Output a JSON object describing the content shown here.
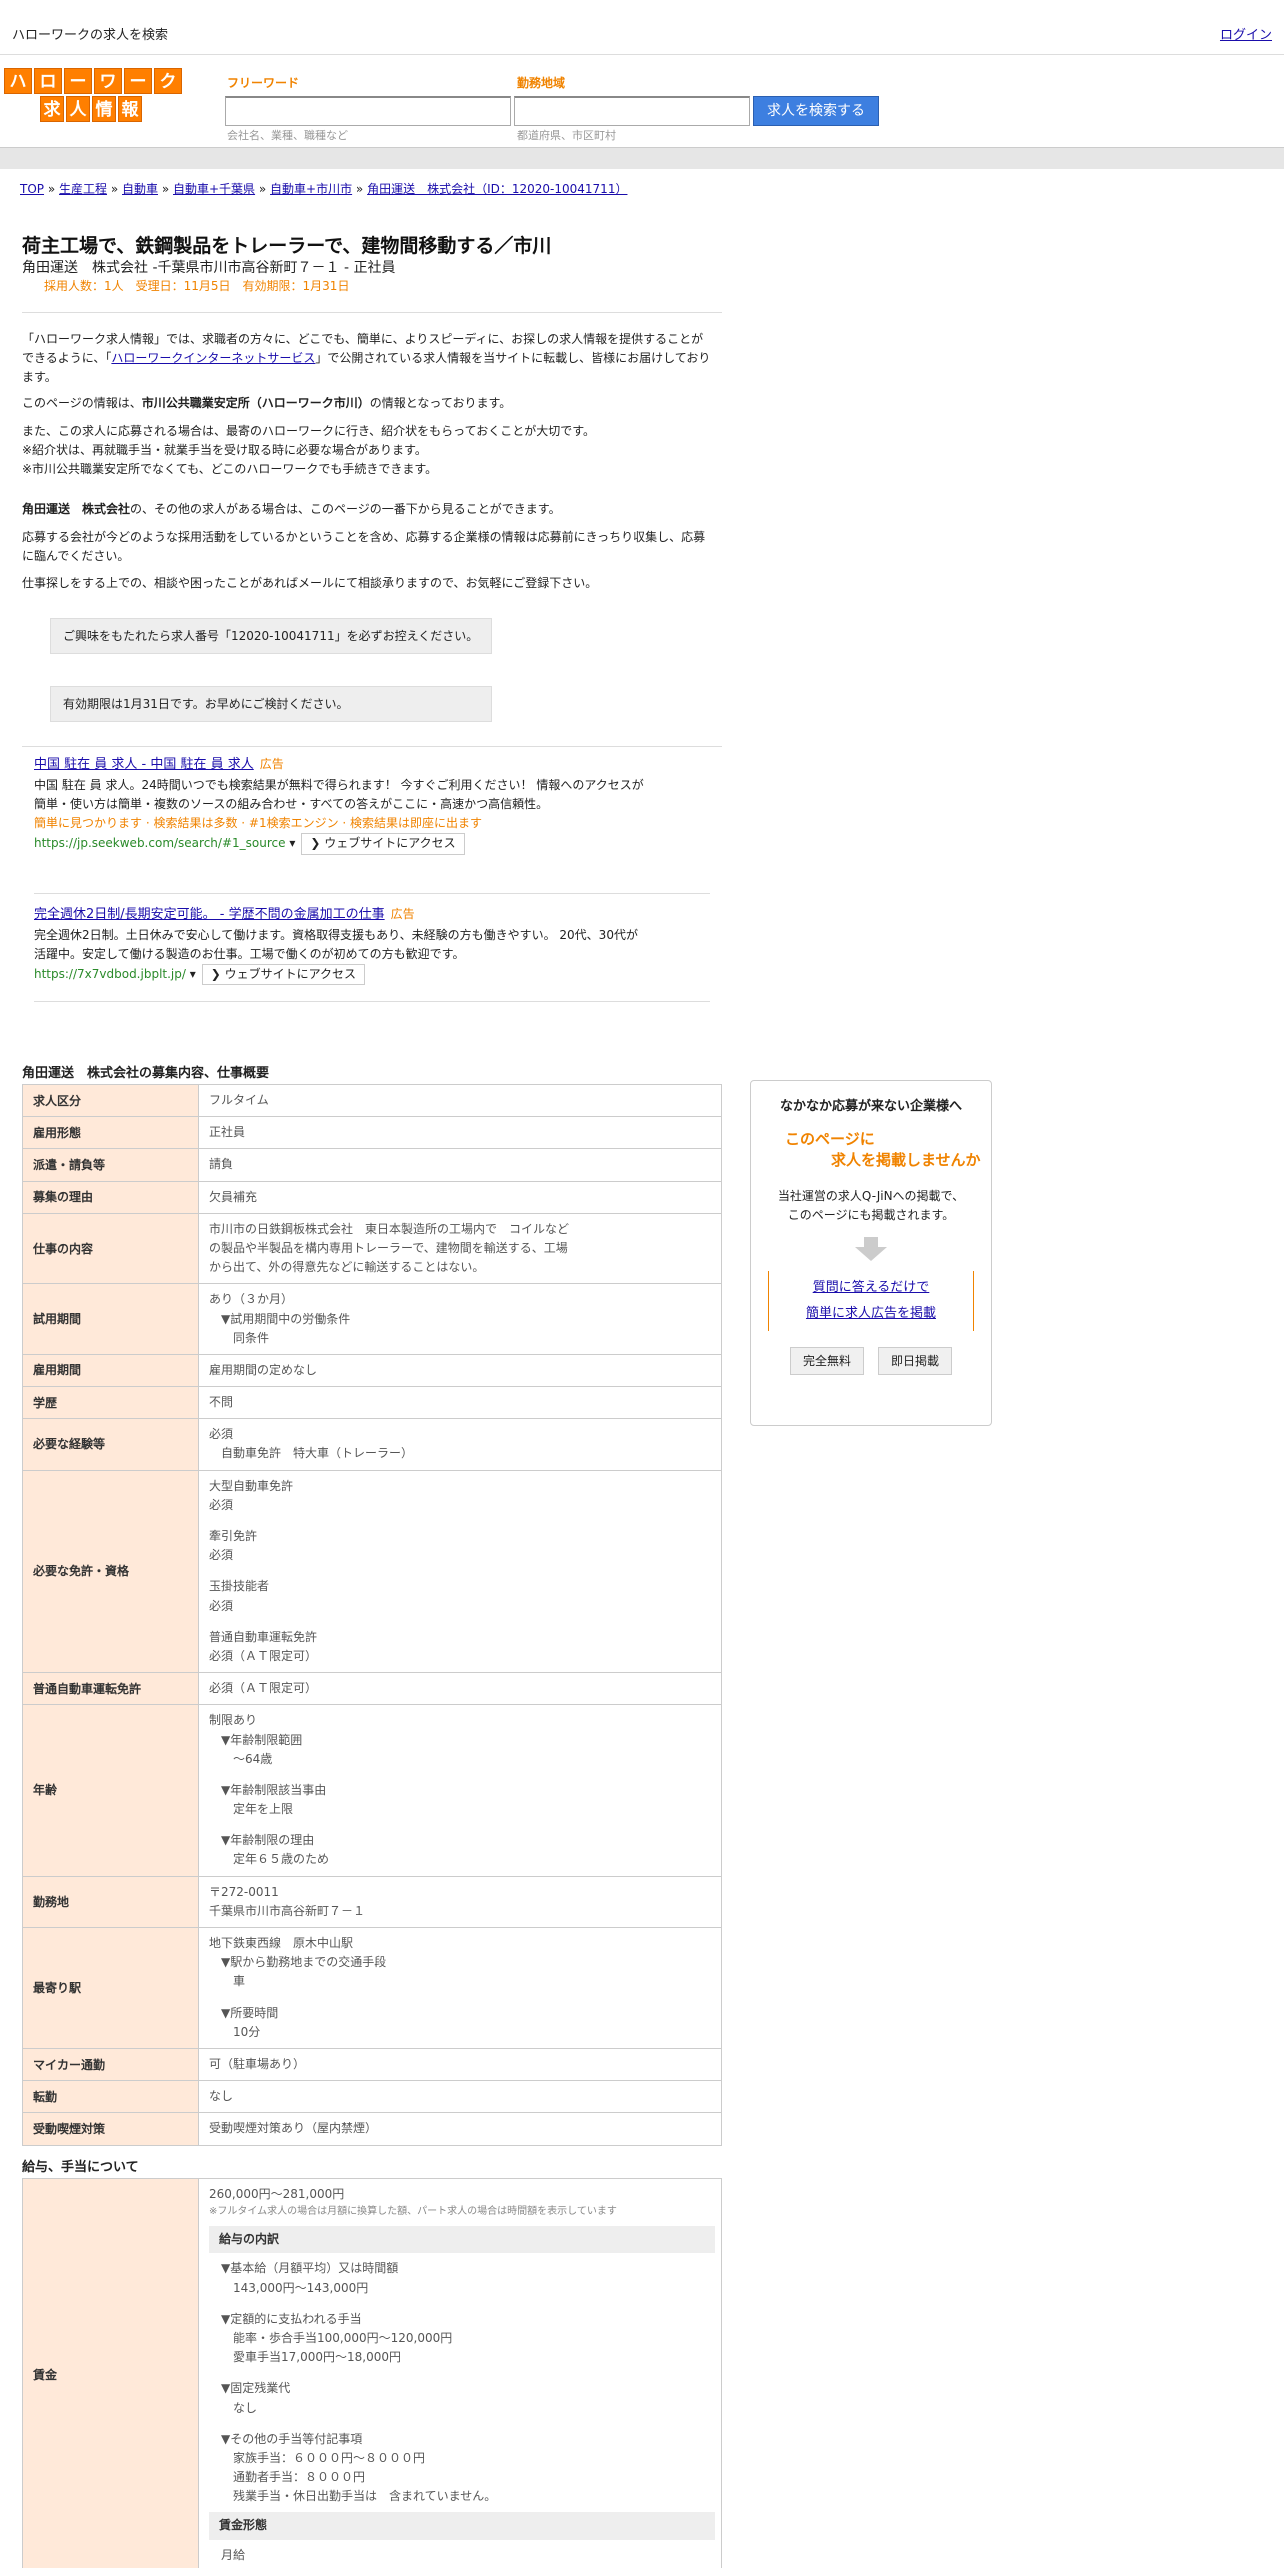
{
  "header": {
    "title": "ハローワークの求人を検索",
    "login": "ログイン"
  },
  "logo": {
    "row1": [
      "ハ",
      "ロ",
      "ー",
      "ワ",
      "ー",
      "ク"
    ],
    "row2": [
      "求",
      "人",
      "情",
      "報"
    ]
  },
  "search": {
    "freeword_label": "フリーワード",
    "freeword_placeholder": "会社名、業種、職種など",
    "area_label": "勤務地域",
    "area_placeholder": "都道府県、市区町村",
    "button": "求人を検索する"
  },
  "breadcrumb": [
    "TOP",
    "生産工程",
    "自動車",
    "自動車+千葉県",
    "自動車+市川市",
    "角田運送　株式会社（ID：12020-10041711）"
  ],
  "job": {
    "title": "荷主工場で、鉄鋼製品をトレーラーで、建物間移動する／市川",
    "subtitle": "角田運送　株式会社 -千葉県市川市高谷新町７－１ - 正社員",
    "meta": "採用人数：1人　受理日：11月5日　有効期限：1月31日"
  },
  "intro": {
    "p1a": "「ハローワーク求人情報」では、求職者の方々に、どこでも、簡単に、よりスピーディに、お探しの求人情報を提供することができるように、「",
    "p1link": "ハローワークインターネットサービス",
    "p1b": "」で公開されている求人情報を当サイトに転載し、皆様にお届けしております。",
    "p2a": "このページの情報は、",
    "p2b": "市川公共職業安定所（ハローワーク市川）",
    "p2c": "の情報となっております。",
    "p3": "また、この求人に応募される場合は、最寄のハローワークに行き、紹介状をもらっておくことが大切です。",
    "p4": "※紹介状は、再就職手当・就業手当を受け取る時に必要な場合があります。",
    "p5": "※市川公共職業安定所でなくても、どこのハローワークでも手続きできます。",
    "p6a": "角田運送　株式会社",
    "p6b": "の、その他の求人がある場合は、このページの一番下から見ることができます。",
    "p7": "応募する会社が今どのような採用活動をしているかということを含め、応募する企業様の情報は応募前にきっちり収集し、応募に臨んでください。",
    "p8": "仕事探しをする上での、相談や困ったことがあればメールにて相談承りますので、お気軽にご登録下さい。",
    "box1": "ご興味をもたれたら求人番号「12020-10041711」を必ずお控えください。",
    "box2": "有効期限は1月31日です。お早めにご検討ください。"
  },
  "ads": [
    {
      "title": "中国 駐在 員 求人 - 中国 駐在 員 求人",
      "tag": "広告",
      "desc": "中国 駐在 員 求人。24時間いつでも検索結果が無料で得られます！ 今すぐご利用ください！ 情報へのアクセスが簡単・使い方は簡単・複数のソースの組み合わせ・すべての答えがここに・高速かつ高信頼性。",
      "orange": "簡単に見つかります · 検索結果は多数 · #1検索エンジン · 検索結果は即座に出ます",
      "url": "https://jp.seekweb.com/search/#1_source",
      "visit": "ウェブサイトにアクセス"
    },
    {
      "title": "完全週休2日制/長期安定可能。 - 学歴不問の金属加工の仕事",
      "tag": "広告",
      "desc": "完全週休2日制。土日休みで安心して働けます。資格取得支援もあり、未経験の方も働きやすい。 20代、30代が活躍中。安定して働ける製造のお仕事。工場で働くのが初めての方も歓迎です。",
      "orange": "",
      "url": "https://7x7vdbod.jbplt.jp/",
      "visit": "ウェブサイトにアクセス"
    }
  ],
  "sections": {
    "overview": "角田運送　株式会社の募集内容、仕事概要",
    "salary": "給与、手当について"
  },
  "rows": [
    {
      "k": "求人区分",
      "v": [
        "フルタイム"
      ]
    },
    {
      "k": "雇用形態",
      "v": [
        "正社員"
      ]
    },
    {
      "k": "派遣・請負等",
      "v": [
        "請負"
      ]
    },
    {
      "k": "募集の理由",
      "v": [
        "欠員補充"
      ]
    },
    {
      "k": "仕事の内容",
      "v": [
        "市川市の日鉄鋼板株式会社　東日本製造所の工場内で　コイルなど",
        "の製品や半製品を構内専用トレーラーで、建物間を輸送する、工場",
        "から出て、外の得意先などに輸送することはない。"
      ]
    },
    {
      "k": "試用期間",
      "v": [
        "あり（３か月）",
        "　▼試用期間中の労働条件",
        "　　同条件"
      ]
    },
    {
      "k": "雇用期間",
      "v": [
        "雇用期間の定めなし"
      ]
    },
    {
      "k": "学歴",
      "v": [
        "不問"
      ]
    },
    {
      "k": "必要な経験等",
      "v": [
        "必須",
        "　自動車免許　特大車（トレーラー）"
      ]
    },
    {
      "k": "必要な免許・資格",
      "v": [
        "大型自動車免許",
        "必須",
        "",
        "牽引免許",
        "必須",
        "",
        "玉掛技能者",
        "必須",
        "",
        "普通自動車運転免許",
        "必須（ＡＴ限定可）"
      ]
    },
    {
      "k": "普通自動車運転免許",
      "v": [
        "必須（ＡＴ限定可）"
      ]
    },
    {
      "k": "年齢",
      "v": [
        "制限あり",
        "　▼年齢制限範囲",
        "　　〜64歳",
        "",
        "　▼年齢制限該当事由",
        "　　定年を上限",
        "",
        "　▼年齢制限の理由",
        "　　定年６５歳のため"
      ]
    },
    {
      "k": "勤務地",
      "v": [
        "〒272-0011",
        "千葉県市川市高谷新町７－１"
      ]
    },
    {
      "k": "最寄り駅",
      "v": [
        "地下鉄東西線　原木中山駅",
        "　▼駅から勤務地までの交通手段",
        "　　車",
        "",
        "　▼所要時間",
        "　　10分"
      ]
    },
    {
      "k": "マイカー通勤",
      "v": [
        "可（駐車場あり）"
      ]
    },
    {
      "k": "転勤",
      "v": [
        "なし"
      ]
    },
    {
      "k": "受動喫煙対策",
      "v": [
        "受動喫煙対策あり（屋内禁煙）"
      ]
    }
  ],
  "salary": {
    "label": "賃金",
    "range": "260,000円〜281,000円",
    "note": "※フルタイム求人の場合は月額に換算した額、パート求人の場合は時間額を表示しています",
    "breakdown_h": "給与の内訳",
    "lines": [
      "▼基本給（月額平均）又は時間額",
      "　143,000円〜143,000円",
      "",
      "▼定額的に支払われる手当",
      "　能率・歩合手当100,000円〜120,000円",
      "　愛車手当17,000円〜18,000円",
      "",
      "▼固定残業代",
      "　なし",
      "",
      "▼その他の手当等付記事項",
      "　家族手当：６０００円～８０００円",
      "　通勤者手当：８０００円",
      "　残業手当・休日出勤手当は　含まれていません。"
    ],
    "form_h": "賃金形態",
    "form": "月給"
  },
  "side": {
    "heading": "なかなか応募が来ない企業様へ",
    "orange1": "このページに",
    "orange2": "求人を掲載しませんか",
    "desc1": "当社運営の求人Q-JiNへの掲載で、",
    "desc2": "このページにも掲載されます。",
    "link1": "質問に答えるだけで",
    "link2": "簡単に求人広告を掲載",
    "btn1": "完全無料",
    "btn2": "即日掲載"
  }
}
